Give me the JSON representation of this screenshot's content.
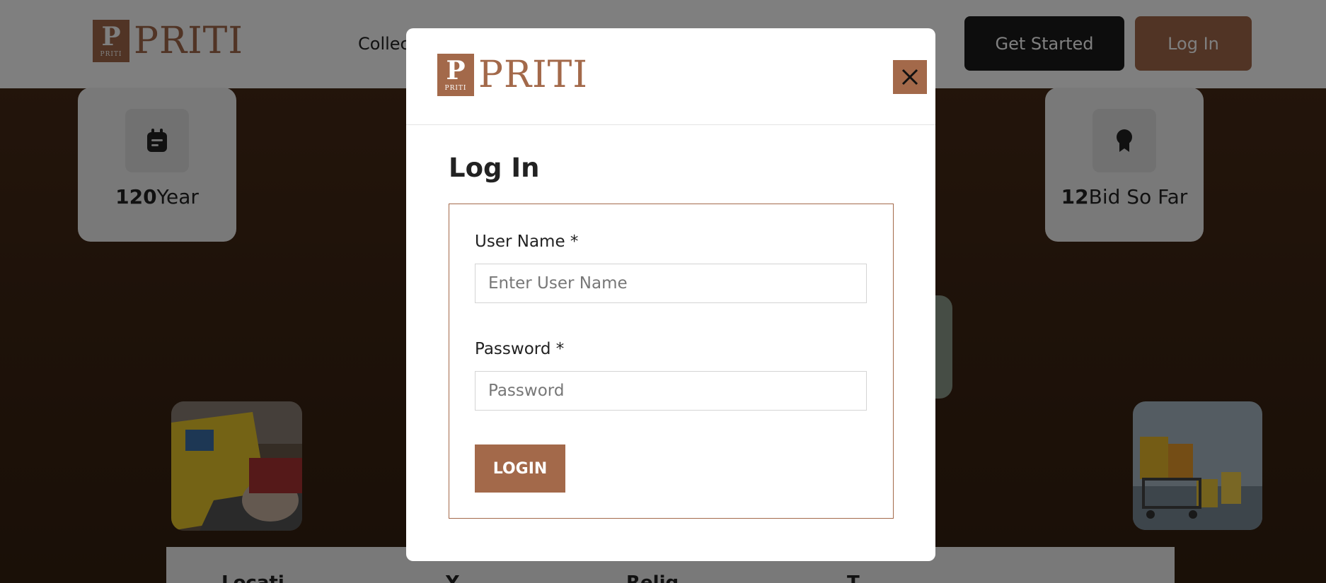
{
  "brand": {
    "name": "PRITI",
    "badge_letter": "P",
    "badge_sub": "PRITI",
    "color": "#a3694a"
  },
  "nav": {
    "link_partial": "Collec",
    "get_started_label": "Get Started",
    "login_label": "Log In"
  },
  "stats": [
    {
      "value": "120",
      "label": "Year",
      "icon": "calendar-icon"
    },
    {
      "value": "12",
      "label": "Bid So Far",
      "icon": "award-icon"
    }
  ],
  "photos": [
    {
      "name": "online-shopping-photo"
    },
    {
      "name": "shopping-cart-photo"
    }
  ],
  "bottom_strip": {
    "items": [
      "Locati",
      "Y",
      "Relig",
      "T"
    ]
  },
  "modal": {
    "close_icon": "close-icon",
    "title": "Log In",
    "username": {
      "label": "User Name *",
      "placeholder": "Enter User Name",
      "value": ""
    },
    "password": {
      "label": "Password *",
      "placeholder": "Password",
      "value": ""
    },
    "submit_label": "LOGIN"
  }
}
